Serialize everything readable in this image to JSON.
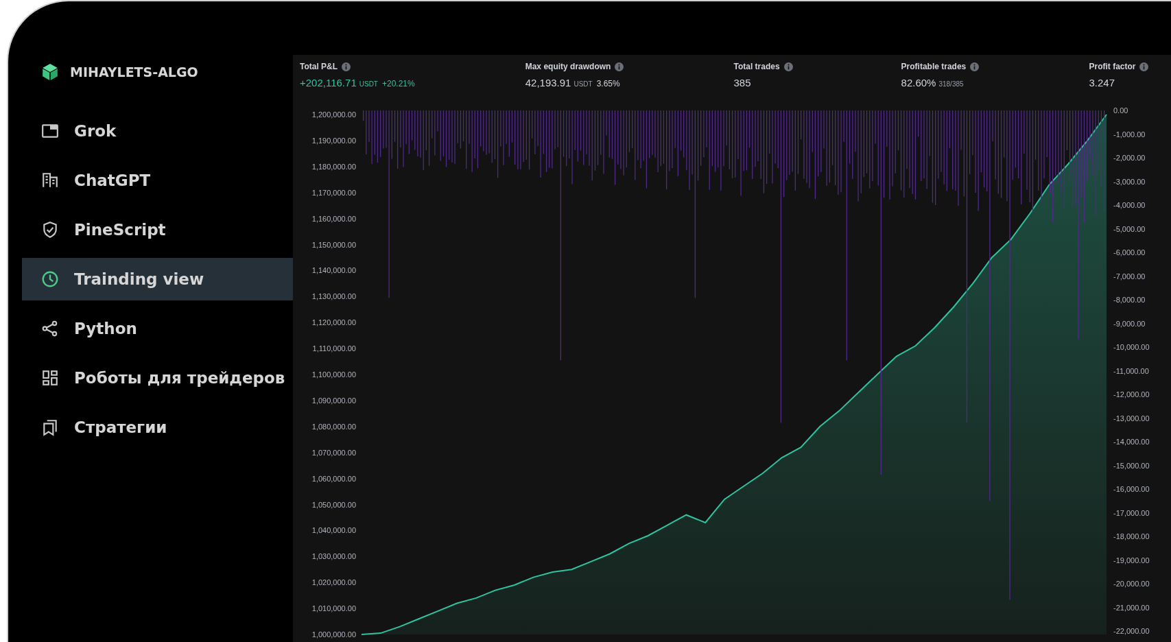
{
  "brand": {
    "name": "MIHAYLETS-ALGO"
  },
  "sidebar": {
    "items": [
      {
        "label": "Grok",
        "selected": false
      },
      {
        "label": "ChatGPT",
        "selected": false
      },
      {
        "label": "PineScript",
        "selected": false
      },
      {
        "label": "Trainding view",
        "selected": true
      },
      {
        "label": "Python",
        "selected": false
      },
      {
        "label": "Роботы для трейдеров",
        "selected": false
      },
      {
        "label": "Стратегии",
        "selected": false
      }
    ]
  },
  "stats": [
    {
      "label": "Total P&L",
      "value": "+202,116.71",
      "unit": "USDT",
      "extra": "+20.21%",
      "positive": true
    },
    {
      "label": "Max equity drawdown",
      "value": "42,193.91",
      "unit": "USDT",
      "extra": "3.65%",
      "positive": false
    },
    {
      "label": "Total trades",
      "value": "385",
      "positive": false
    },
    {
      "label": "Profitable trades",
      "value": "82.60%",
      "unit": "318/385",
      "positive": false
    },
    {
      "label": "Profit factor",
      "value": "3.247",
      "positive": false
    }
  ],
  "chart": {
    "equity": {
      "chart_data": {
        "type": "area",
        "categories": [
          null,
          null,
          null,
          null,
          null,
          null,
          null,
          null,
          null,
          null,
          null,
          null,
          null,
          null,
          null,
          null,
          null,
          null,
          null,
          null,
          null,
          null,
          null,
          null,
          null,
          null,
          null,
          null,
          null,
          null,
          null,
          null,
          null,
          null,
          null,
          null,
          null,
          null,
          null,
          null
        ],
        "ylim": [
          1000000,
          1200000
        ],
        "yticks": [
          {
            "value": 1200000,
            "label": "1,200,000.00"
          },
          {
            "value": 1190000,
            "label": "1,190,000.00"
          },
          {
            "value": 1180000,
            "label": "1,180,000.00"
          },
          {
            "value": 1170000,
            "label": "1,170,000.00"
          },
          {
            "value": 1160000,
            "label": "1,160,000.00"
          },
          {
            "value": 1150000,
            "label": "1,150,000.00"
          },
          {
            "value": 1140000,
            "label": "1,140,000.00"
          },
          {
            "value": 1130000,
            "label": "1,130,000.00"
          },
          {
            "value": 1120000,
            "label": "1,120,000.00"
          },
          {
            "value": 1110000,
            "label": "1,110,000.00"
          },
          {
            "value": 1100000,
            "label": "1,100,000.00"
          },
          {
            "value": 1090000,
            "label": "1,090,000.00"
          },
          {
            "value": 1080000,
            "label": "1,080,000.00"
          },
          {
            "value": 1070000,
            "label": "1,070,000.00"
          },
          {
            "value": 1060000,
            "label": "1,060,000.00"
          },
          {
            "value": 1050000,
            "label": "1,050,000.00"
          },
          {
            "value": 1040000,
            "label": "1,040,000.00"
          },
          {
            "value": 1030000,
            "label": "1,030,000.00"
          },
          {
            "value": 1020000,
            "label": "1,020,000.00"
          },
          {
            "value": 1010000,
            "label": "1,010,000.00"
          },
          {
            "value": 1000000,
            "label": "1,000,000.00"
          }
        ],
        "series": [
          {
            "color": "#2ec4a0",
            "values": [
              1000000,
              1000500,
              1003000,
              1006000,
              1009000,
              1012000,
              1014000,
              1017000,
              1019000,
              1022000,
              1024000,
              1025000,
              1028000,
              1031000,
              1035000,
              1038000,
              1042000,
              1046000,
              1043000,
              1052000,
              1057000,
              1062000,
              1068000,
              1072000,
              1080000,
              1086000,
              1093000,
              1100000,
              1107000,
              1111000,
              1118000,
              1126000,
              1135000,
              1145000,
              1152000,
              1162000,
              1173000,
              1181000,
              1190000,
              1200000
            ]
          }
        ]
      }
    },
    "drawdown": {
      "axis_labels": [
        "0.00",
        "-1,000.00",
        "-2,000.00",
        "-3,000.00",
        "-4,000.00",
        "-5,000.00",
        "-6,000.00",
        "-7,000.00",
        "-8,000.00",
        "-9,000.00",
        "-10,000.00",
        "-11,000.00",
        "-12,000.00",
        "-13,000.00",
        "-14,000.00",
        "-15,000.00",
        "-16,000.00",
        "-17,000.00",
        "-18,000.00",
        "-19,000.00",
        "-20,000.00",
        "-21,000.00",
        "-22,000.00"
      ]
    }
  }
}
